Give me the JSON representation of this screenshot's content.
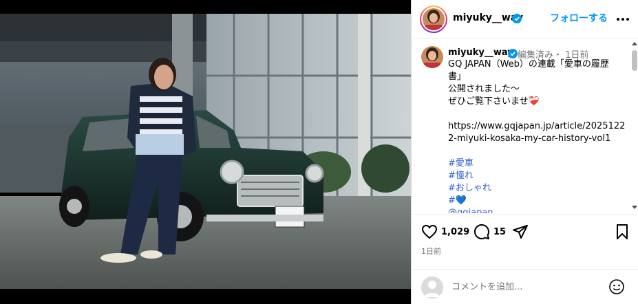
{
  "post": {
    "username": "miyuky__way",
    "follow_label": "フォローする",
    "caption": {
      "meta": "編集済み・ 1日前",
      "lines": [
        "GQ JAPAN（Web）の連載「愛車の履歴",
        "書」",
        "公開されました〜",
        "ぜひご覧下さいませ❤️‍🩹",
        "",
        "https://www.gqjapan.jp/article/2025122",
        "2-miyuki-kosaka-my-car-history-vol1",
        ""
      ],
      "tags": [
        "#愛車",
        "#憧れ",
        "#おしゃれ",
        "#💙",
        "@gqjapan"
      ]
    },
    "likes": "1,029",
    "comments": "15",
    "timestamp": "1日前",
    "comment_placeholder": "コメントを追加..."
  },
  "colors": {
    "accent": "#0095f6",
    "tag": "#2f5fd8",
    "muted": "#737373",
    "car": "#1f3a33"
  },
  "icons": {
    "verified": "verified-badge-icon",
    "more": "more-horizontal-icon",
    "like": "heart-icon",
    "comment": "comment-bubble-icon",
    "share": "paper-plane-icon",
    "save": "bookmark-icon",
    "emoji": "smiley-icon"
  }
}
